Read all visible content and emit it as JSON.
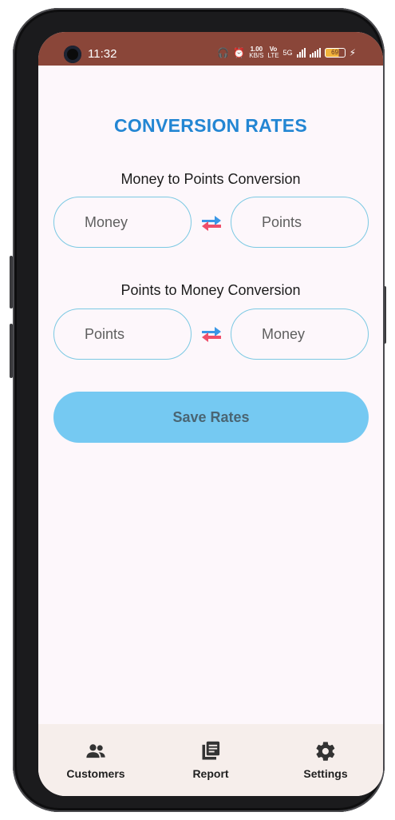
{
  "status_bar": {
    "time": "11:32",
    "net_speed_value": "1.00",
    "net_speed_unit": "KB/S",
    "vo_label": "Vo",
    "lte_label": "LTE",
    "network_5g": "5G",
    "battery_level": "69"
  },
  "page": {
    "title": "CONVERSION RATES"
  },
  "money_to_points": {
    "label": "Money to Points Conversion",
    "money_placeholder": "Money",
    "points_placeholder": "Points"
  },
  "points_to_money": {
    "label": "Points to Money Conversion",
    "points_placeholder": "Points",
    "money_placeholder": "Money"
  },
  "save_button": {
    "label": "Save Rates"
  },
  "bottom_nav": {
    "items": [
      {
        "label": "Customers",
        "icon": "people-icon"
      },
      {
        "label": "Report",
        "icon": "report-icon"
      },
      {
        "label": "Settings",
        "icon": "gear-icon"
      }
    ]
  },
  "colors": {
    "status_bar": "#8a4639",
    "title": "#2386d3",
    "field_border": "#7cc9e3",
    "save_button": "#75c9f2",
    "swap_blue": "#3a97e6",
    "swap_red": "#ef4f6a",
    "nav_background": "#f6eeeb"
  }
}
